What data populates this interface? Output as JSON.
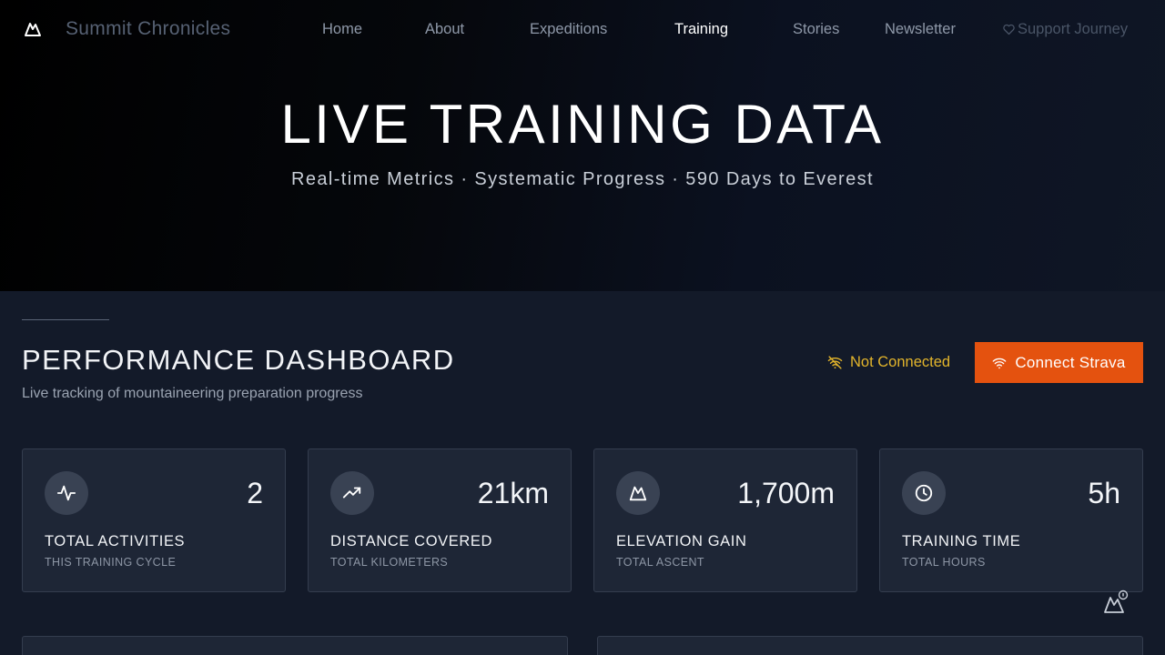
{
  "nav": {
    "brand": "Summit Chronicles",
    "links": [
      "Home",
      "About",
      "Expeditions",
      "Training",
      "Stories",
      "Newsletter"
    ],
    "active": "Training",
    "support_label": "Support Journey",
    "logo_icon": "mountain-icon",
    "support_icon": "heart-icon"
  },
  "hero": {
    "title": "LIVE TRAINING DATA",
    "subtitle": "Real-time Metrics · Systematic Progress · 590 Days to Everest"
  },
  "dashboard": {
    "title": "PERFORMANCE DASHBOARD",
    "subtitle": "Live tracking of mountaineering preparation progress",
    "status_label": "Not Connected",
    "status_icon": "wifi-off-icon",
    "connect_label": "Connect Strava",
    "connect_icon": "wifi-icon",
    "colors": {
      "accent": "#e4520f",
      "warning": "#e3b52b",
      "card": "#1e2636"
    }
  },
  "stats": [
    {
      "value": "2",
      "label": "TOTAL ACTIVITIES",
      "sub": "THIS TRAINING CYCLE",
      "icon": "activity-icon"
    },
    {
      "value": "21km",
      "label": "DISTANCE COVERED",
      "sub": "TOTAL KILOMETERS",
      "icon": "trending-up-icon"
    },
    {
      "value": "1,700m",
      "label": "ELEVATION GAIN",
      "sub": "TOTAL ASCENT",
      "icon": "mountain-icon"
    },
    {
      "value": "5h",
      "label": "TRAINING TIME",
      "sub": "TOTAL HOURS",
      "icon": "clock-icon"
    }
  ]
}
